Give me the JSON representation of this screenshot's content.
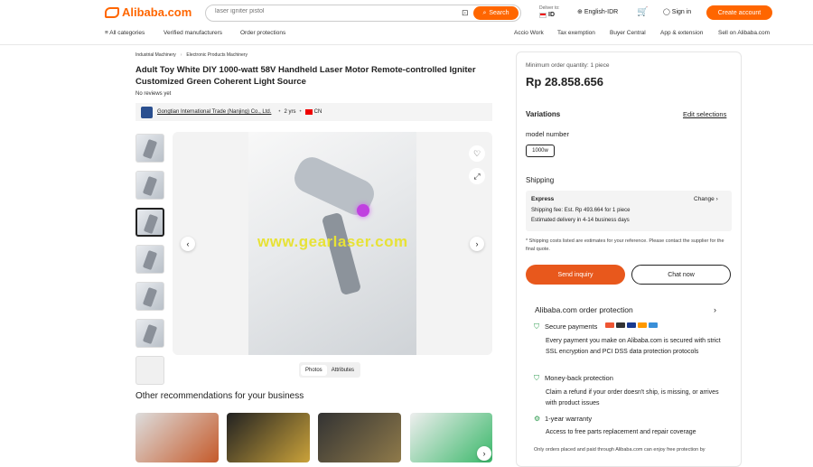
{
  "header": {
    "logo": "Alibaba.com",
    "search_placeholder": "laser igniter pistol",
    "search_button": "Search",
    "deliver_to": "Deliver to:",
    "country": "ID",
    "language": "English-IDR",
    "sign_in": "Sign in",
    "create_account": "Create account"
  },
  "nav": {
    "all_categories": "All categories",
    "verified": "Verified manufacturers",
    "protections": "Order protections",
    "accio": "Accio Work",
    "tax": "Tax exemption",
    "buyer_central": "Buyer Central",
    "app": "App & extension",
    "sell": "Sell on Alibaba.com"
  },
  "breadcrumb": [
    "Industrial Machinery",
    "Electronic Products Machinery"
  ],
  "product": {
    "title": "Adult Toy White DIY 1000-watt 58V Handheld Laser Motor Remote-controlled Igniter Customized Green Coherent Light Source",
    "reviews": "No reviews yet",
    "supplier": "Gongtian International Trade (Nanjing) Co., Ltd.",
    "years": "2 yrs",
    "country": "CN",
    "watermark": "www.gearlaser.com",
    "tab_photos": "Photos",
    "tab_attributes": "Attributes"
  },
  "recommendations_title": "Other recommendations for your business",
  "panel": {
    "min_order": "Minimum order quantity: 1 piece",
    "price": "Rp 28.858.656",
    "variations": "Variations",
    "edit_selections": "Edit selections",
    "model_number": "model number",
    "model_option": "1000w",
    "shipping": "Shipping",
    "express": "Express",
    "change": "Change",
    "shipping_fee": "Shipping fee: Est. Rp 493.664 for 1 piece",
    "delivery": "Estimated delivery in 4-14 business days",
    "disclaimer": "* Shipping costs listed are estimates for your reference. Please contact the supplier for the final quote.",
    "send_inquiry": "Send inquiry",
    "chat_now": "Chat now",
    "protection_title": "Alibaba.com order protection",
    "secure_payments": "Secure payments",
    "secure_desc": "Every payment you make on Alibaba.com is secured with strict SSL encryption and PCI DSS data protection protocols",
    "money_back": "Money-back protection",
    "money_desc": "Claim a refund if your order doesn't ship, is missing, or arrives with product issues",
    "warranty": "1-year warranty",
    "warranty_desc": "Access to free parts replacement and repair coverage",
    "footer_note": "Only orders placed and paid through Alibaba.com can enjoy free protection by"
  },
  "colors": {
    "brand": "#ff6600",
    "inquiry": "#e8581c"
  }
}
